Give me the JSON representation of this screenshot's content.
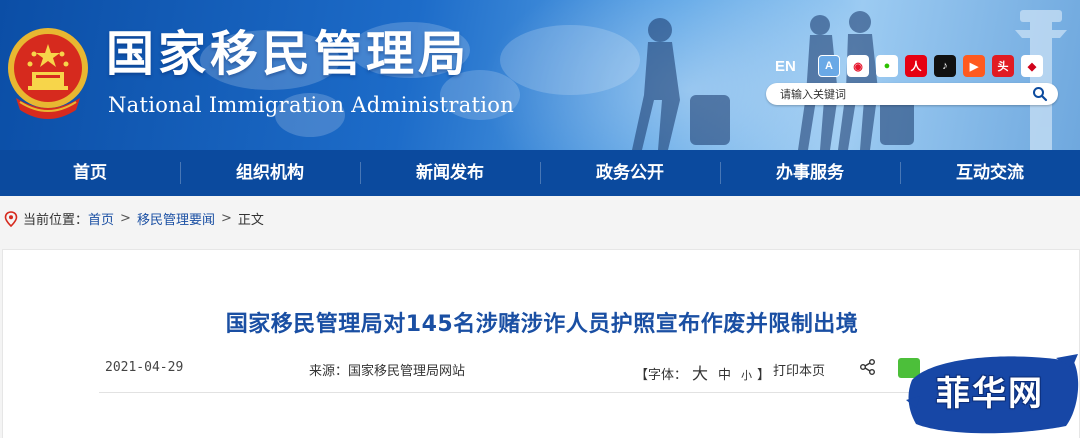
{
  "header": {
    "title_cn": "国家移民管理局",
    "title_en": "National Immigration Administration",
    "lang_switch": "EN",
    "social_icons": [
      "app-icon",
      "weibo-icon",
      "wechat-icon",
      "renmin-icon",
      "douyin-icon",
      "kuaishou-icon",
      "toutiao-icon",
      "news-icon"
    ],
    "search_placeholder": "请输入关键词"
  },
  "nav": {
    "items": [
      "首页",
      "组织机构",
      "新闻发布",
      "政务公开",
      "办事服务",
      "互动交流"
    ]
  },
  "breadcrumb": {
    "label": "当前位置：",
    "items": [
      "首页",
      "移民管理要闻",
      "正文"
    ]
  },
  "article": {
    "title": "国家移民管理局对145名涉赌涉诈人员护照宣布作废并限制出境",
    "date": "2021-04-29",
    "source": "来源：国家移民管理局网站",
    "font_open": "【字体：",
    "font_large": "大",
    "font_medium": "中",
    "font_small": "小",
    "font_close": "】",
    "print": "打印本页"
  },
  "watermark": {
    "text": "菲华网"
  },
  "colors": {
    "nav_bg": "#0b4a9e",
    "title_blue": "#1a4fa3",
    "banner_blue": "#1d6cc9"
  }
}
